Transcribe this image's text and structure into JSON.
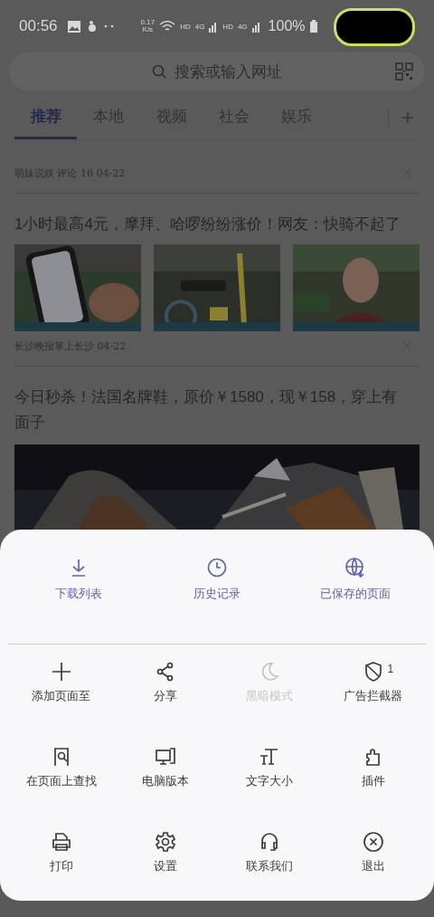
{
  "status_bar": {
    "time": "00:56",
    "net_speed_value": "0.17",
    "net_speed_unit": "K/s",
    "hd_1": "HD",
    "gen_1": "4G",
    "hd_2": "HD",
    "gen_2": "4G",
    "battery": "100%"
  },
  "search": {
    "placeholder": "搜索或输入网址"
  },
  "tabs": [
    {
      "label": "推荐",
      "selected": true
    },
    {
      "label": "本地",
      "selected": false
    },
    {
      "label": "视频",
      "selected": false
    },
    {
      "label": "社会",
      "selected": false
    },
    {
      "label": "娱乐",
      "selected": false
    }
  ],
  "add_tab": "+",
  "feed": [
    {
      "meta": "萌妹说娱 评论 16 04-22"
    },
    {
      "headline": "1小时最高4元，摩拜、哈啰纷纷涨价！网友：快骑不起了",
      "meta": "长沙晚报掌上长沙 04-22"
    },
    {
      "headline": "今日秒杀！法国名牌鞋，原价￥1580，现￥158，穿上有面子"
    }
  ],
  "menu": {
    "top": [
      {
        "label": "下载列表"
      },
      {
        "label": "历史记录"
      },
      {
        "label": "已保存的页面"
      }
    ],
    "grid": [
      {
        "label": "添加页面至",
        "disabled": false
      },
      {
        "label": "分享",
        "disabled": false
      },
      {
        "label": "黑暗模式",
        "disabled": true
      },
      {
        "label": "广告拦截器",
        "disabled": false,
        "badge": "1"
      },
      {
        "label": "在页面上查找",
        "disabled": false
      },
      {
        "label": "电脑版本",
        "disabled": false
      },
      {
        "label": "文字大小",
        "disabled": false
      },
      {
        "label": "插件",
        "disabled": false
      },
      {
        "label": "打印",
        "disabled": false
      },
      {
        "label": "设置",
        "disabled": false
      },
      {
        "label": "联系我们",
        "disabled": false
      },
      {
        "label": "退出",
        "disabled": false
      }
    ]
  }
}
